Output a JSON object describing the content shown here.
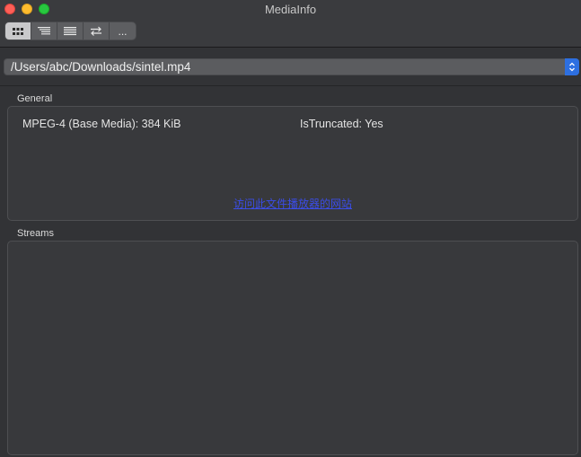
{
  "window": {
    "title": "MediaInfo"
  },
  "toolbar": {
    "buttons": [
      {
        "name": "basic-view",
        "icon": "grid-icon"
      },
      {
        "name": "tree-view",
        "icon": "tree-icon"
      },
      {
        "name": "text-view",
        "icon": "list-icon"
      },
      {
        "name": "compare-view",
        "icon": "arrows-icon"
      },
      {
        "name": "more",
        "label": "..."
      }
    ]
  },
  "file": {
    "path": "/Users/abc/Downloads/sintel.mp4"
  },
  "general": {
    "label": "General",
    "format_info": "MPEG-4 (Base Media): 384 KiB",
    "truncated_info": "IsTruncated: Yes",
    "link_text": "访问此文件播放器的网站"
  },
  "streams": {
    "label": "Streams"
  },
  "colors": {
    "accent": "#2d6fe0",
    "link": "#3b4de8",
    "close": "#fe5f57",
    "minimize": "#febc2e",
    "maximize": "#28c840"
  }
}
